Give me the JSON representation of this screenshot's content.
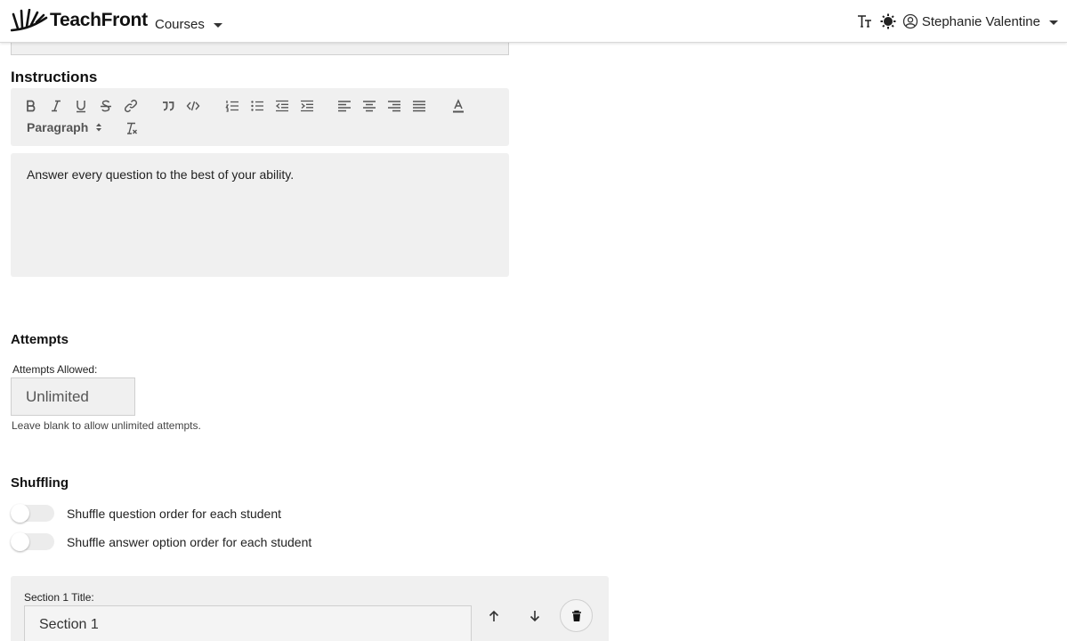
{
  "header": {
    "brand_name": "TeachFront",
    "courses_label": "Courses",
    "user_name": "Stephanie Valentine",
    "text_size_glyph": "TT"
  },
  "instructions": {
    "heading": "Instructions",
    "paragraph_style": "Paragraph",
    "body_text": "Answer every question to the best of your ability."
  },
  "attempts": {
    "heading": "Attempts",
    "field_label": "Attempts Allowed:",
    "placeholder": "Unlimited",
    "help_text": "Leave blank to allow unlimited attempts."
  },
  "shuffling": {
    "heading": "Shuffling",
    "options": [
      {
        "label": "Shuffle question order for each student",
        "enabled": false
      },
      {
        "label": "Shuffle answer option order for each student",
        "enabled": false
      }
    ]
  },
  "section": {
    "title_label": "Section 1 Title:",
    "title_value": "Section 1"
  },
  "toolbar_icons": [
    "bold-icon",
    "italic-icon",
    "underline-icon",
    "strikethrough-icon",
    "link-icon",
    "blockquote-icon",
    "code-icon",
    "ordered-list-icon",
    "bullet-list-icon",
    "outdent-icon",
    "indent-icon",
    "align-left-icon",
    "align-center-icon",
    "align-right-icon",
    "justify-icon",
    "text-color-icon",
    "clear-format-icon"
  ],
  "colors": {
    "panel_bg": "#f0f0f0",
    "text": "#1f1f1f",
    "border": "#cfcfcf"
  }
}
